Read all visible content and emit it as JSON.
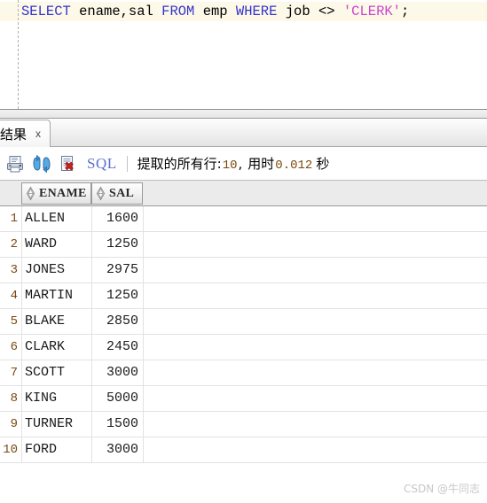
{
  "editor": {
    "sql_tokens": [
      {
        "text": "SELECT",
        "type": "keyword"
      },
      {
        "text": " ",
        "type": "plain"
      },
      {
        "text": "ename,sal",
        "type": "identifier"
      },
      {
        "text": " ",
        "type": "plain"
      },
      {
        "text": "FROM",
        "type": "keyword"
      },
      {
        "text": " ",
        "type": "plain"
      },
      {
        "text": "emp",
        "type": "identifier"
      },
      {
        "text": " ",
        "type": "plain"
      },
      {
        "text": "WHERE",
        "type": "keyword"
      },
      {
        "text": " ",
        "type": "plain"
      },
      {
        "text": "job",
        "type": "identifier"
      },
      {
        "text": " ",
        "type": "plain"
      },
      {
        "text": "<>",
        "type": "operator"
      },
      {
        "text": " ",
        "type": "plain"
      },
      {
        "text": "'CLERK'",
        "type": "string"
      },
      {
        "text": ";",
        "type": "punctuation"
      }
    ],
    "sql_plain": "SELECT ename,sal FROM emp WHERE job <> 'CLERK';",
    "keyword_color": "#3333cc",
    "string_color": "#cc44cc",
    "current_line_color": "#fdf9e8"
  },
  "tabs": [
    {
      "label": "询结果",
      "close_label": "x",
      "active": true
    }
  ],
  "toolbar": {
    "icons": [
      {
        "name": "print-icon",
        "title": "print"
      },
      {
        "name": "refresh-icon",
        "title": "refresh"
      },
      {
        "name": "clear-icon",
        "title": "clear"
      }
    ],
    "sql_label": "SQL",
    "status": {
      "prefix": "提取的所有行:",
      "row_count": "10",
      "separator": ",",
      "time_label": "用时",
      "time_value": "0.012",
      "time_unit": "秒",
      "full_text": "提取的所有行: 10, 用时 0.012 秒"
    }
  },
  "grid": {
    "columns": [
      {
        "key": "ename",
        "label": "ENAME",
        "sort_icon": "sort-updown-icon",
        "align": "left"
      },
      {
        "key": "sal",
        "label": "SAL",
        "sort_icon": "sort-updown-icon",
        "align": "right"
      }
    ],
    "rows": [
      {
        "num": "1",
        "ename": "ALLEN",
        "sal": "1600"
      },
      {
        "num": "2",
        "ename": "WARD",
        "sal": "1250"
      },
      {
        "num": "3",
        "ename": "JONES",
        "sal": "2975"
      },
      {
        "num": "4",
        "ename": "MARTIN",
        "sal": "1250"
      },
      {
        "num": "5",
        "ename": "BLAKE",
        "sal": "2850"
      },
      {
        "num": "6",
        "ename": "CLARK",
        "sal": "2450"
      },
      {
        "num": "7",
        "ename": "SCOTT",
        "sal": "3000"
      },
      {
        "num": "8",
        "ename": "KING",
        "sal": "5000"
      },
      {
        "num": "9",
        "ename": "TURNER",
        "sal": "1500"
      },
      {
        "num": "10",
        "ename": "FORD",
        "sal": "3000"
      }
    ]
  },
  "watermark": {
    "text": "CSDN @牛同志"
  }
}
